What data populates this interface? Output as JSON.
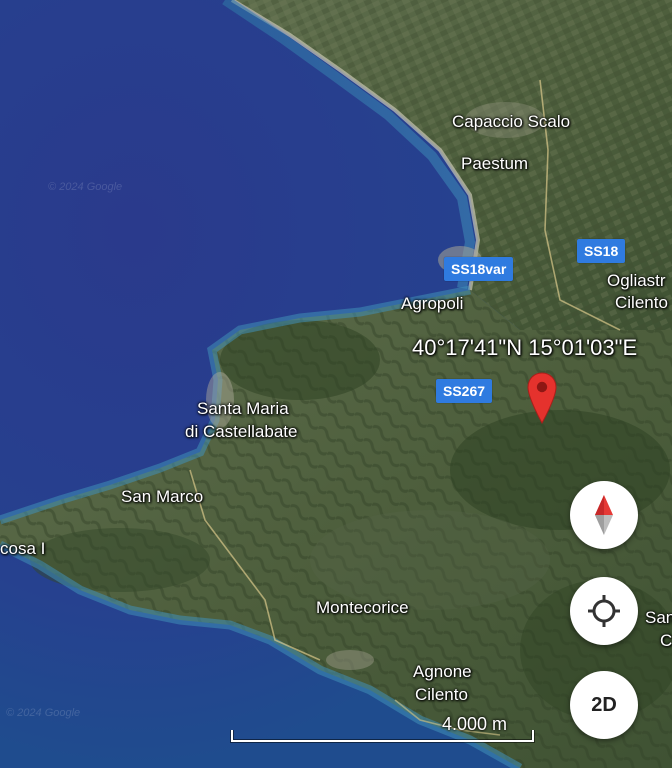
{
  "map": {
    "places": [
      {
        "id": "capaccio-scalo",
        "label": "Capaccio Scalo"
      },
      {
        "id": "paestum",
        "label": "Paestum"
      },
      {
        "id": "ogliastro-cilento",
        "label_line1": "Ogliastr",
        "label_line2": "Cilento"
      },
      {
        "id": "agropoli",
        "label": "Agropoli"
      },
      {
        "id": "santa-maria-di-castellabate",
        "label_line1": "Santa Maria",
        "label_line2": "di Castellabate"
      },
      {
        "id": "san-marco",
        "label": "San Marco"
      },
      {
        "id": "licosa",
        "label": "cosa I"
      },
      {
        "id": "montecorice",
        "label": "Montecorice"
      },
      {
        "id": "agnone-cilento",
        "label_line1": "Agnone",
        "label_line2": "Cilento"
      },
      {
        "id": "right-edge-san",
        "label_line1": "San",
        "label_line2": "C"
      }
    ],
    "roads": [
      {
        "id": "ss18var",
        "label": "SS18var"
      },
      {
        "id": "ss18",
        "label": "SS18"
      },
      {
        "id": "ss267",
        "label": "SS267"
      }
    ],
    "coordinates": "40°17'41\"N 15°01'03\"E",
    "scale_label": "4.000 m",
    "watermark_1": "© 2024 Google",
    "watermark_2": "© 2024 Google",
    "pin_icon": "location-pin-icon",
    "colors": {
      "sea": "#2a3f86",
      "pin": "#e5322d",
      "road_badge": "#2f7be0"
    }
  },
  "controls": {
    "compass_icon": "compass-icon",
    "locate_icon": "my-location-icon",
    "view_toggle_label": "2D"
  }
}
